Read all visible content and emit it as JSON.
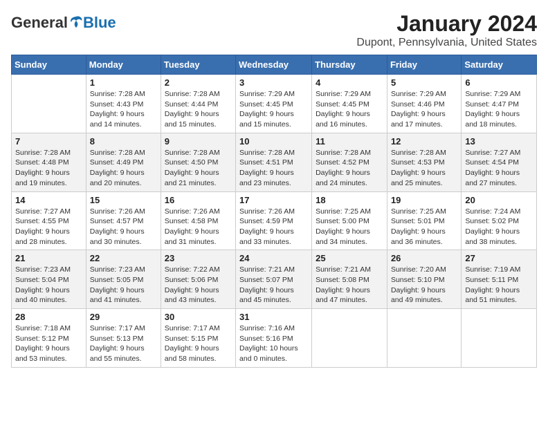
{
  "header": {
    "logo": {
      "general": "General",
      "blue": "Blue"
    },
    "title": "January 2024",
    "subtitle": "Dupont, Pennsylvania, United States"
  },
  "calendar": {
    "days_of_week": [
      "Sunday",
      "Monday",
      "Tuesday",
      "Wednesday",
      "Thursday",
      "Friday",
      "Saturday"
    ],
    "weeks": [
      [
        {
          "day": "",
          "info": ""
        },
        {
          "day": "1",
          "info": "Sunrise: 7:28 AM\nSunset: 4:43 PM\nDaylight: 9 hours\nand 14 minutes."
        },
        {
          "day": "2",
          "info": "Sunrise: 7:28 AM\nSunset: 4:44 PM\nDaylight: 9 hours\nand 15 minutes."
        },
        {
          "day": "3",
          "info": "Sunrise: 7:29 AM\nSunset: 4:45 PM\nDaylight: 9 hours\nand 15 minutes."
        },
        {
          "day": "4",
          "info": "Sunrise: 7:29 AM\nSunset: 4:45 PM\nDaylight: 9 hours\nand 16 minutes."
        },
        {
          "day": "5",
          "info": "Sunrise: 7:29 AM\nSunset: 4:46 PM\nDaylight: 9 hours\nand 17 minutes."
        },
        {
          "day": "6",
          "info": "Sunrise: 7:29 AM\nSunset: 4:47 PM\nDaylight: 9 hours\nand 18 minutes."
        }
      ],
      [
        {
          "day": "7",
          "info": "Sunrise: 7:28 AM\nSunset: 4:48 PM\nDaylight: 9 hours\nand 19 minutes."
        },
        {
          "day": "8",
          "info": "Sunrise: 7:28 AM\nSunset: 4:49 PM\nDaylight: 9 hours\nand 20 minutes."
        },
        {
          "day": "9",
          "info": "Sunrise: 7:28 AM\nSunset: 4:50 PM\nDaylight: 9 hours\nand 21 minutes."
        },
        {
          "day": "10",
          "info": "Sunrise: 7:28 AM\nSunset: 4:51 PM\nDaylight: 9 hours\nand 23 minutes."
        },
        {
          "day": "11",
          "info": "Sunrise: 7:28 AM\nSunset: 4:52 PM\nDaylight: 9 hours\nand 24 minutes."
        },
        {
          "day": "12",
          "info": "Sunrise: 7:28 AM\nSunset: 4:53 PM\nDaylight: 9 hours\nand 25 minutes."
        },
        {
          "day": "13",
          "info": "Sunrise: 7:27 AM\nSunset: 4:54 PM\nDaylight: 9 hours\nand 27 minutes."
        }
      ],
      [
        {
          "day": "14",
          "info": "Sunrise: 7:27 AM\nSunset: 4:55 PM\nDaylight: 9 hours\nand 28 minutes."
        },
        {
          "day": "15",
          "info": "Sunrise: 7:26 AM\nSunset: 4:57 PM\nDaylight: 9 hours\nand 30 minutes."
        },
        {
          "day": "16",
          "info": "Sunrise: 7:26 AM\nSunset: 4:58 PM\nDaylight: 9 hours\nand 31 minutes."
        },
        {
          "day": "17",
          "info": "Sunrise: 7:26 AM\nSunset: 4:59 PM\nDaylight: 9 hours\nand 33 minutes."
        },
        {
          "day": "18",
          "info": "Sunrise: 7:25 AM\nSunset: 5:00 PM\nDaylight: 9 hours\nand 34 minutes."
        },
        {
          "day": "19",
          "info": "Sunrise: 7:25 AM\nSunset: 5:01 PM\nDaylight: 9 hours\nand 36 minutes."
        },
        {
          "day": "20",
          "info": "Sunrise: 7:24 AM\nSunset: 5:02 PM\nDaylight: 9 hours\nand 38 minutes."
        }
      ],
      [
        {
          "day": "21",
          "info": "Sunrise: 7:23 AM\nSunset: 5:04 PM\nDaylight: 9 hours\nand 40 minutes."
        },
        {
          "day": "22",
          "info": "Sunrise: 7:23 AM\nSunset: 5:05 PM\nDaylight: 9 hours\nand 41 minutes."
        },
        {
          "day": "23",
          "info": "Sunrise: 7:22 AM\nSunset: 5:06 PM\nDaylight: 9 hours\nand 43 minutes."
        },
        {
          "day": "24",
          "info": "Sunrise: 7:21 AM\nSunset: 5:07 PM\nDaylight: 9 hours\nand 45 minutes."
        },
        {
          "day": "25",
          "info": "Sunrise: 7:21 AM\nSunset: 5:08 PM\nDaylight: 9 hours\nand 47 minutes."
        },
        {
          "day": "26",
          "info": "Sunrise: 7:20 AM\nSunset: 5:10 PM\nDaylight: 9 hours\nand 49 minutes."
        },
        {
          "day": "27",
          "info": "Sunrise: 7:19 AM\nSunset: 5:11 PM\nDaylight: 9 hours\nand 51 minutes."
        }
      ],
      [
        {
          "day": "28",
          "info": "Sunrise: 7:18 AM\nSunset: 5:12 PM\nDaylight: 9 hours\nand 53 minutes."
        },
        {
          "day": "29",
          "info": "Sunrise: 7:17 AM\nSunset: 5:13 PM\nDaylight: 9 hours\nand 55 minutes."
        },
        {
          "day": "30",
          "info": "Sunrise: 7:17 AM\nSunset: 5:15 PM\nDaylight: 9 hours\nand 58 minutes."
        },
        {
          "day": "31",
          "info": "Sunrise: 7:16 AM\nSunset: 5:16 PM\nDaylight: 10 hours\nand 0 minutes."
        },
        {
          "day": "",
          "info": ""
        },
        {
          "day": "",
          "info": ""
        },
        {
          "day": "",
          "info": ""
        }
      ]
    ]
  }
}
